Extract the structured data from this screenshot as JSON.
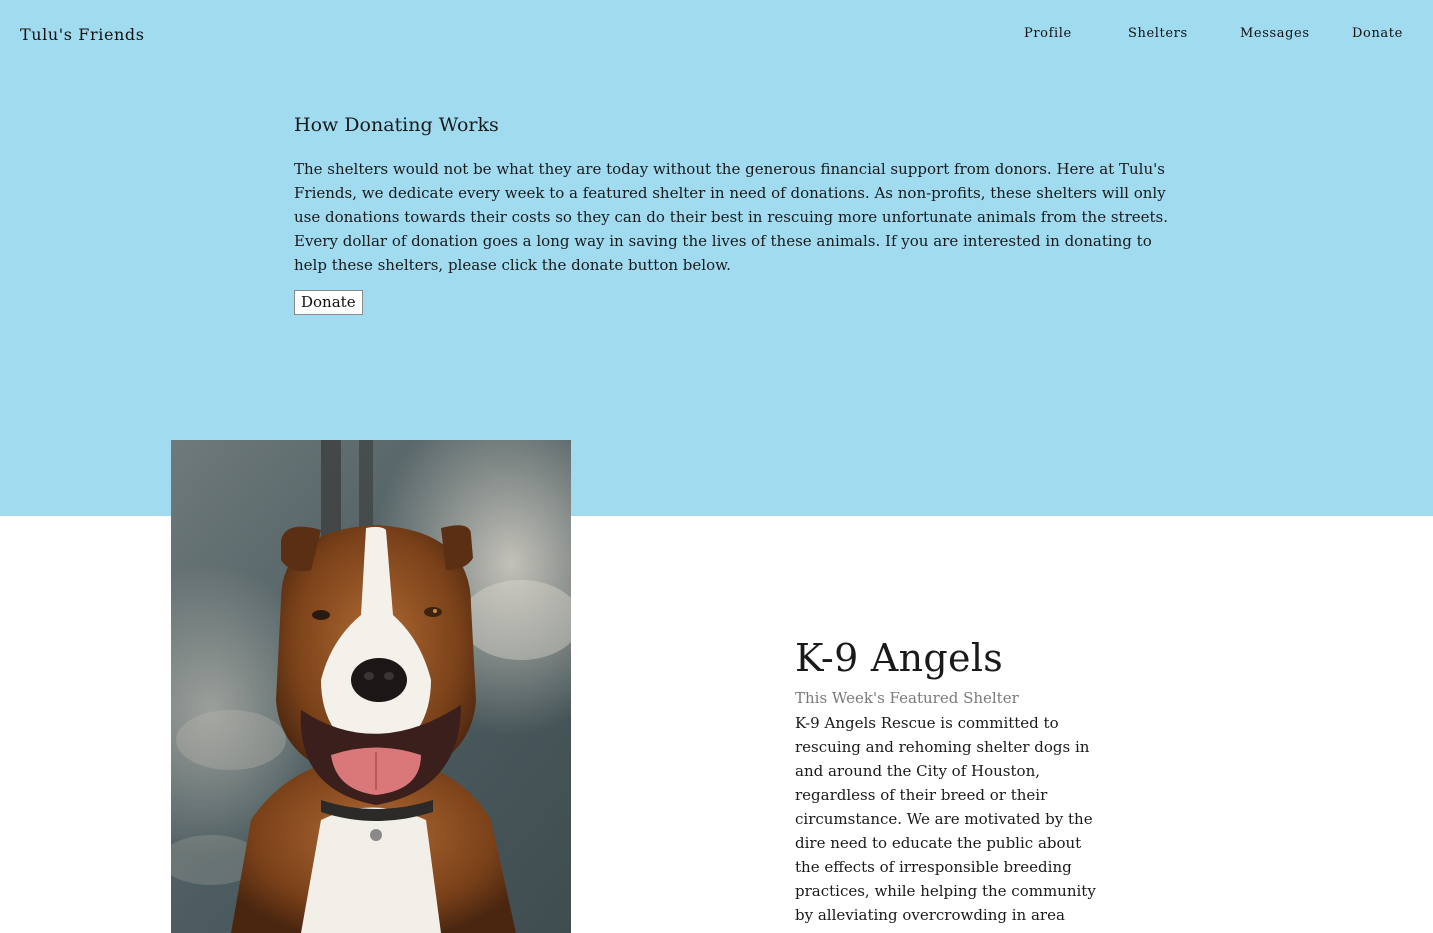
{
  "header": {
    "brand": "Tulu's Friends",
    "nav": {
      "profile": "Profile",
      "shelters": "Shelters",
      "messages": "Messages",
      "donate": "Donate"
    }
  },
  "how_donating": {
    "title": "How Donating Works",
    "body": "The shelters would not be what they are today without the generous financial support from donors. Here at Tulu's Friends, we dedicate every week to a featured shelter in need of donations. As non-profits, these shelters will only use donations towards their costs so they can do their best in rescuing more unfortunate animals from the streets. Every dollar of donation goes a long way in saving the lives of these animals. If you are interested in donating to help these shelters, please click the donate button below.",
    "button_label": "Donate"
  },
  "featured": {
    "name": "K-9 Angels",
    "subtitle": "This Week's Featured Shelter",
    "description": "K-9 Angels Rescue is committed to rescuing and rehoming shelter dogs in and around the City of Houston, regardless of their breed or their circumstance. We are motivated by the dire need to educate the public about the effects of irresponsible breeding practices, while helping the community by alleviating overcrowding in area"
  },
  "colors": {
    "hero_background": "#a0dbf0",
    "text": "#1a1a1a",
    "subtitle": "#7a7a7a"
  }
}
